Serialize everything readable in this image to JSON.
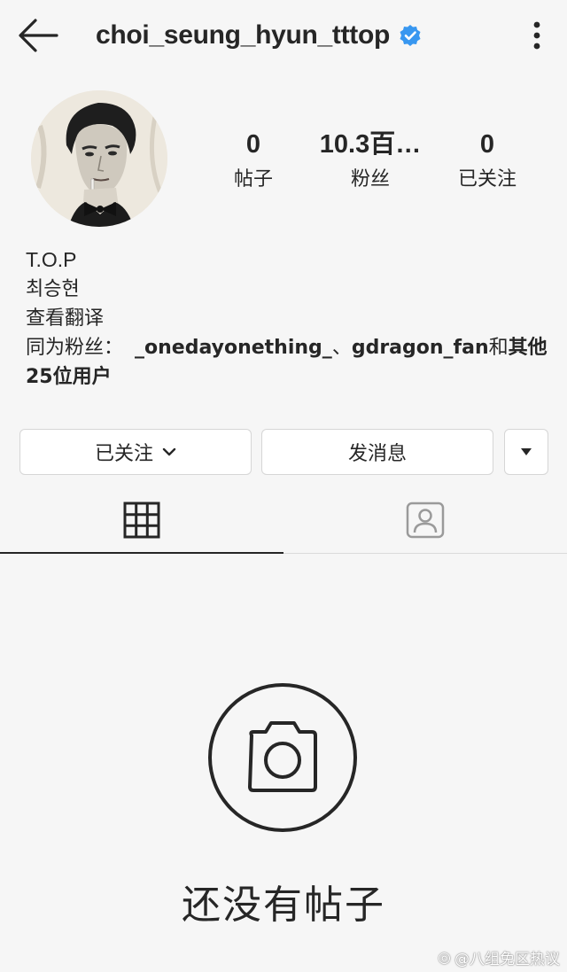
{
  "header": {
    "username": "choi_seung_hyun_tttop",
    "verified": true,
    "back_icon": "arrow-left-icon",
    "more_icon": "more-vertical-icon"
  },
  "stats": [
    {
      "value": "0",
      "label": "帖子"
    },
    {
      "value": "10.3百…",
      "label": "粉丝"
    },
    {
      "value": "0",
      "label": "已关注"
    }
  ],
  "bio": {
    "name": "T.O.P",
    "line2": "최승현",
    "translate": "查看翻译",
    "mutual_prefix": "同为粉丝：",
    "mutual_user1": "_onedayonething_",
    "mutual_sep": "、",
    "mutual_user2": "gdragon_fan",
    "mutual_and": "和",
    "mutual_others": "其他25位用户"
  },
  "buttons": {
    "following": "已关注",
    "message": "发消息"
  },
  "tabs": [
    {
      "name": "grid",
      "icon": "grid-icon",
      "active": true
    },
    {
      "name": "tagged",
      "icon": "tagged-person-icon",
      "active": false
    }
  ],
  "empty_state": {
    "icon": "camera-icon",
    "text": "还没有帖子"
  },
  "watermark": "@八组免区热议",
  "colors": {
    "verified_badge": "#3897f0",
    "background": "#f6f6f6",
    "text": "#262626"
  }
}
